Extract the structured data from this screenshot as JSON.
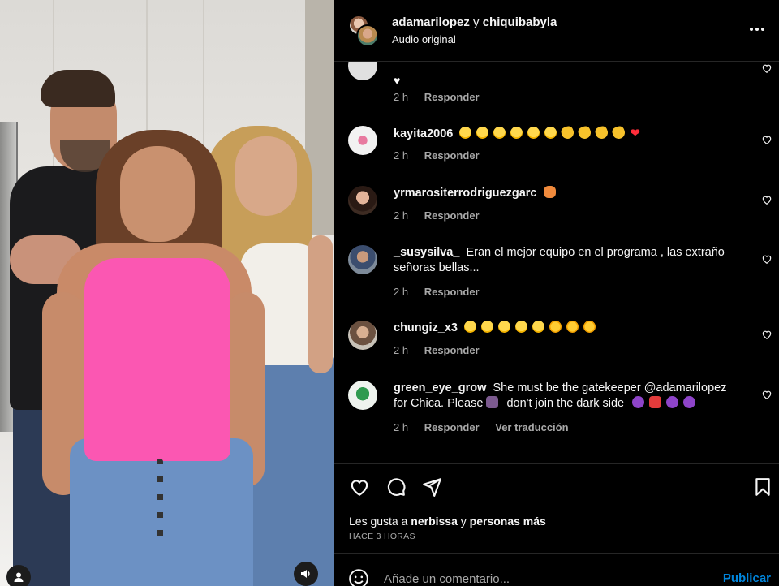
{
  "post": {
    "authors": "adamarilopez",
    "connector": "y",
    "coauthor": "chiquibabyla",
    "audio": "Audio original"
  },
  "comments": [
    {
      "username": "",
      "text": "",
      "emojis": [
        "heart-white"
      ],
      "time": "2 h",
      "reply": "Responder"
    },
    {
      "username": "kayita2006",
      "text": "",
      "emojis": [
        "laugh",
        "laugh",
        "laugh",
        "laugh",
        "laugh",
        "laugh",
        "clap",
        "clap",
        "clap",
        "clap",
        "heart"
      ],
      "time": "2 h",
      "reply": "Responder"
    },
    {
      "username": "yrmarositerrodriguezgarc",
      "text": "",
      "emojis": [
        "raised-hands"
      ],
      "time": "2 h",
      "reply": "Responder"
    },
    {
      "username": "_susysilva_",
      "text": "Eran el mejor equipo en el programa , las extraño señoras bellas...",
      "emojis": [],
      "time": "2 h",
      "reply": "Responder"
    },
    {
      "username": "chungiz_x3",
      "text": "",
      "emojis": [
        "laugh",
        "laugh",
        "laugh",
        "laugh",
        "laugh",
        "star-eyes",
        "star-eyes",
        "star-eyes"
      ],
      "time": "2 h",
      "reply": "Responder"
    },
    {
      "username": "green_eye_grow",
      "text": "She must be the gatekeeper @adamarilopez for Chica. Please",
      "text2": "don't join the dark side",
      "emojis": [
        "devil",
        "ogre",
        "purple",
        "purple"
      ],
      "time": "2 h",
      "reply": "Responder",
      "translate": "Ver traducción"
    }
  ],
  "actions": {
    "likes_prefix": "Les gusta a",
    "likes_user": "nerbissa",
    "likes_connector": "y",
    "likes_suffix": "personas más",
    "timestamp": "HACE 3 HORAS"
  },
  "composer": {
    "placeholder": "Añade un comentario...",
    "publish_label": "Publicar"
  },
  "icons": {
    "more": "more-horizontal-icon",
    "like": "heart-outline-icon",
    "comment": "comment-bubble-icon",
    "share": "paper-plane-icon",
    "save": "bookmark-icon",
    "emoji": "smiley-icon",
    "sound": "speaker-icon",
    "tags": "user-tag-icon"
  },
  "colors": {
    "accent": "#0095f6",
    "secondary_text": "#a8a8a8",
    "background": "#000000"
  }
}
